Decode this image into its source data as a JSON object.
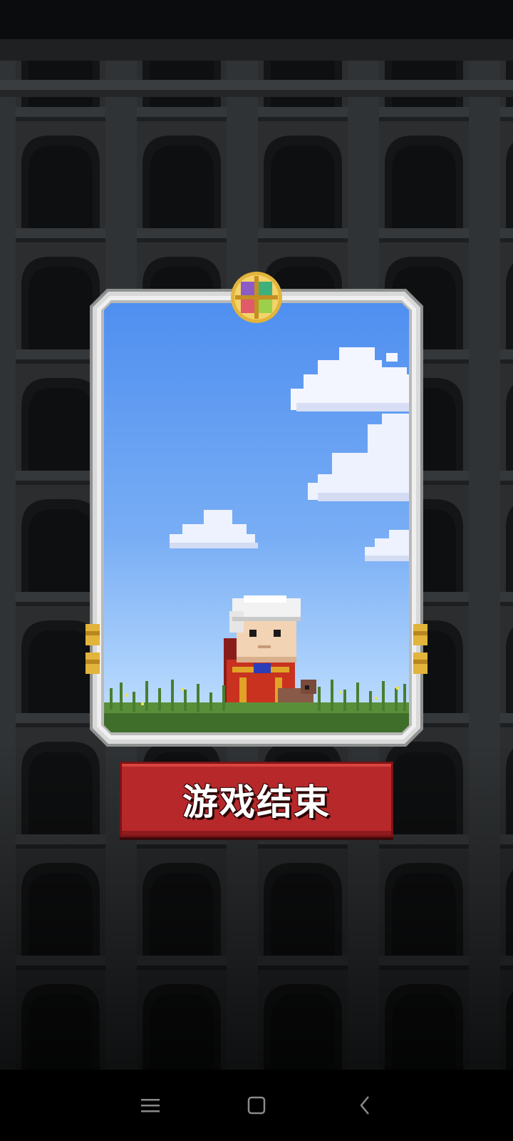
{
  "game": {
    "game_over_label": "游戏结束"
  },
  "icons": {
    "emblem": "quad-emblem-icon",
    "menu": "menu-icon",
    "home": "home-square-icon",
    "back": "back-chevron-icon"
  },
  "colors": {
    "button_red": "#b7282b",
    "sky_top": "#4f8ff0",
    "sky_bottom": "#bfe0ff",
    "frame_silver": "#d7d7d7",
    "gold": "#e2b43b"
  }
}
